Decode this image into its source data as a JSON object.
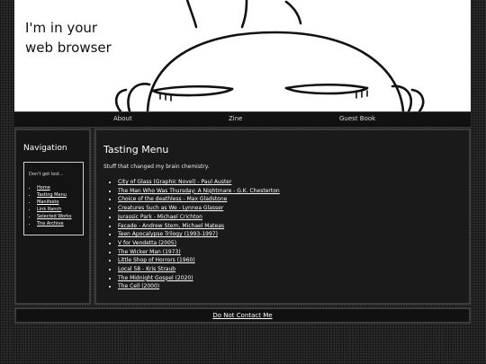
{
  "banner": {
    "title_line1": "I'm in your",
    "title_line2": "web browser"
  },
  "topnav": {
    "items": [
      {
        "label": "About"
      },
      {
        "label": "Zine"
      },
      {
        "label": "Guest Book"
      }
    ]
  },
  "sidebar": {
    "heading": "Navigation",
    "lead": "Don't get lost...",
    "links": [
      "Home",
      "Tasting Menu",
      "Manifesto",
      "Link Ranch",
      "Selected Works",
      "The Archive"
    ]
  },
  "main": {
    "heading": "Tasting Menu",
    "intro": "Stuff that changed my brain chemistry.",
    "items": [
      "City of Glass (Graphic Novel) - Paul Auster",
      "The Man Who Was Thursday: A Nightmare - G.K. Chesterton",
      "Choice of the deathless - Max Gladstone",
      "Creatures Such as We - Lynnea Glasser",
      "Jurassic Park - Michael Crichton",
      "Facade - Andrew Stern, Michael Mateas",
      "Teen Apocalypse Trilogy (1993-1997)",
      "V for Vendetta (2005)",
      "The Wicker Man (1973)",
      "Little Shop of Horrors (1960)",
      "Local 58 - Kris Straub",
      "The Midnight Gospel (2020)",
      "The Cell (2000)"
    ]
  },
  "footer": {
    "link": "Do Not Contact Me"
  }
}
